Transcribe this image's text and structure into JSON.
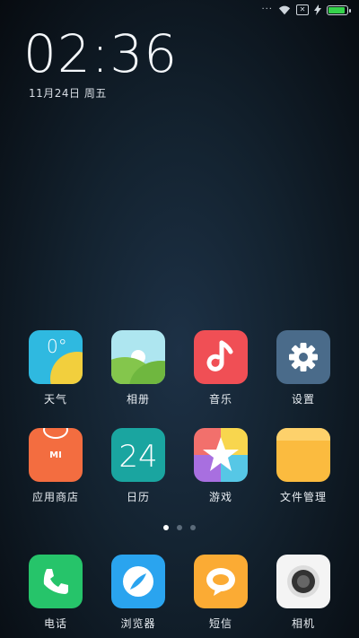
{
  "status": {
    "signal_dots": "···",
    "sim_label": "✕",
    "battery_level": 0.82,
    "battery_color": "#35d24b"
  },
  "lockscreen": {
    "time": "02:36",
    "date": "11月24日 周五"
  },
  "apps": [
    {
      "name": "天气",
      "icon": "weather-icon",
      "temp": "0°"
    },
    {
      "name": "相册",
      "icon": "gallery-icon"
    },
    {
      "name": "音乐",
      "icon": "music-icon"
    },
    {
      "name": "设置",
      "icon": "settings-gear-icon"
    },
    {
      "name": "应用商店",
      "icon": "app-store-icon",
      "badge": "MI"
    },
    {
      "name": "日历",
      "icon": "calendar-icon",
      "day": "24"
    },
    {
      "name": "游戏",
      "icon": "games-star-icon"
    },
    {
      "name": "文件管理",
      "icon": "folder-icon"
    }
  ],
  "page_indicator": {
    "count": 3,
    "active": 0
  },
  "dock": [
    {
      "name": "电话",
      "icon": "phone-icon"
    },
    {
      "name": "浏览器",
      "icon": "browser-icon"
    },
    {
      "name": "短信",
      "icon": "message-icon"
    },
    {
      "name": "相机",
      "icon": "camera-icon"
    }
  ]
}
